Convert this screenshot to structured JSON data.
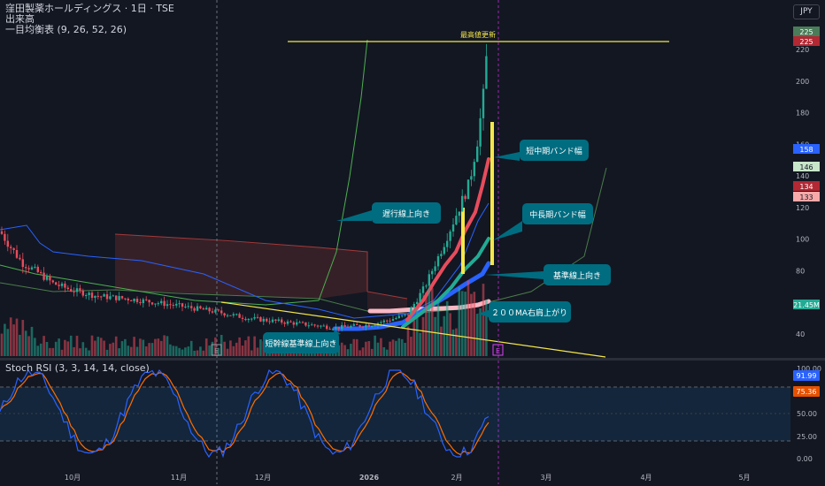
{
  "header": {
    "symbol_line": "窪田製薬ホールディングス · 1日 · TSE",
    "volume_label": "出来高",
    "ichimoku_label": "一目均衡表 (9, 26, 52, 26)",
    "currency": "JPY"
  },
  "stoch_panel": {
    "label": "Stoch RSI (3, 3, 14, 14, close)",
    "k_value": "91.99",
    "d_value": "75.36",
    "ticks": [
      "100.00",
      "75.00",
      "50.00",
      "25.00",
      "0.00"
    ]
  },
  "price_axis": {
    "ticks": [
      "220",
      "200",
      "180",
      "160",
      "140",
      "120",
      "100",
      "80",
      "60",
      "40"
    ]
  },
  "price_badges": [
    {
      "text": "225",
      "color": "#4a7c59"
    },
    {
      "text": "225",
      "color": "#b22833"
    },
    {
      "text": "158",
      "color": "#2962ff"
    },
    {
      "text": "146",
      "color": "#c8e6c9"
    },
    {
      "text": "134",
      "color": "#b22833"
    },
    {
      "text": "133",
      "color": "#f7a8a8"
    },
    {
      "text": "21.45M",
      "color": "#22ab94"
    }
  ],
  "time_axis": {
    "labels": [
      "10月",
      "11月",
      "12月",
      "2026",
      "2月",
      "3月",
      "4月",
      "5月"
    ]
  },
  "annotations": {
    "high_update": "最高値更新",
    "short_mid_band": "短中期バンド幅",
    "chikou_up": "遅行線上向き",
    "mid_long_band": "中長期バンド幅",
    "kijun_up": "基準線上向き",
    "ma200_up": "２００MA右肩上がり",
    "tenkan_kijun_up": "短幹線基準線上向き"
  },
  "earnings_marker": "E",
  "chart_data": {
    "type": "candlestick",
    "price_range": [
      30,
      235
    ],
    "approx_path": [
      {
        "date": "2025-09-05",
        "close": 100
      },
      {
        "date": "2025-09-20",
        "close": 85
      },
      {
        "date": "2025-10-10",
        "close": 70
      },
      {
        "date": "2025-11-05",
        "close": 60
      },
      {
        "date": "2025-12-01",
        "close": 52
      },
      {
        "date": "2026-01-05",
        "close": 45
      },
      {
        "date": "2026-01-20",
        "close": 55
      },
      {
        "date": "2026-01-30",
        "close": 95
      },
      {
        "date": "2026-02-05",
        "close": 140
      },
      {
        "date": "2026-02-09",
        "close": 225
      },
      {
        "date": "2026-02-12",
        "close": 134
      }
    ],
    "resistance_line": 225,
    "stoch_range": [
      0,
      100
    ],
    "stoch_bands": [
      20,
      80
    ]
  }
}
